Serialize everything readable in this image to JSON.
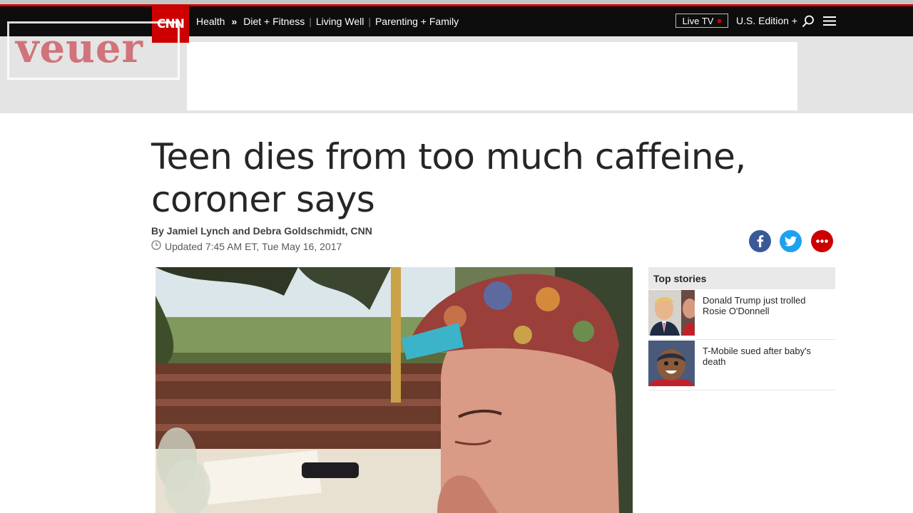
{
  "watermark": {
    "text": "veuer"
  },
  "header": {
    "logo": "CNN",
    "section": "Health",
    "nav": [
      "Diet + Fitness",
      "Living Well",
      "Parenting + Family"
    ],
    "live_tv": "Live TV",
    "edition": "U.S. Edition +"
  },
  "article": {
    "headline_line1": "Teen dies from too much caffeine,",
    "headline_line2": "coroner says",
    "byline": "By Jamiel Lynch and Debra Goldschmidt, CNN",
    "updated": "Updated 7:45 AM ET, Tue May 16, 2017"
  },
  "top_stories": {
    "heading": "Top stories",
    "items": [
      {
        "line1": "Donald Trump just trolled",
        "line2": "Rosie O'Donnell"
      },
      {
        "line1": "T-Mobile sued after baby's",
        "line2": "death"
      }
    ]
  },
  "icons": {
    "search": "search-icon",
    "menu": "hamburger-menu-icon",
    "facebook": "facebook-icon",
    "twitter": "twitter-icon",
    "more": "more-options-icon",
    "clock": "clock-icon"
  },
  "colors": {
    "brand_red": "#cc0000",
    "facebook": "#3b5998",
    "twitter": "#1da1f2"
  }
}
